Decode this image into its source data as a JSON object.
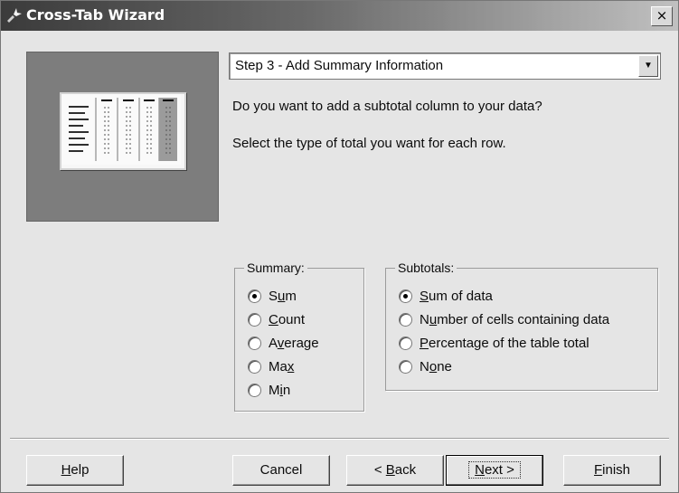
{
  "window": {
    "title": "Cross-Tab Wizard",
    "close_label": "×"
  },
  "step_select": {
    "value": "Step 3 - Add Summary Information"
  },
  "question": "Do you want to add a subtotal column to your data?",
  "instruction": "Select the type of total you want for each row.",
  "summary": {
    "legend": "Summary:",
    "selected": "Sum",
    "options": [
      {
        "pre": "S",
        "key": "u",
        "post": "m"
      },
      {
        "pre": "",
        "key": "C",
        "post": "ount"
      },
      {
        "pre": "A",
        "key": "v",
        "post": "erage"
      },
      {
        "pre": "Ma",
        "key": "x",
        "post": ""
      },
      {
        "pre": "M",
        "key": "i",
        "post": "n"
      }
    ]
  },
  "subtotals": {
    "legend": "Subtotals:",
    "selected": "Sum of data",
    "options": [
      {
        "pre": "",
        "key": "S",
        "post": "um of data"
      },
      {
        "pre": "N",
        "key": "u",
        "post": "mber of cells containing data"
      },
      {
        "pre": "",
        "key": "P",
        "post": "ercentage of the table total"
      },
      {
        "pre": "N",
        "key": "o",
        "post": "ne"
      }
    ]
  },
  "buttons": {
    "help": {
      "pre": "",
      "key": "H",
      "post": "elp"
    },
    "cancel": "Cancel",
    "back": {
      "pre": "< ",
      "key": "B",
      "post": "ack"
    },
    "next": {
      "pre": "",
      "key": "N",
      "post": "ext >"
    },
    "finish": {
      "pre": "",
      "key": "F",
      "post": "inish"
    }
  }
}
